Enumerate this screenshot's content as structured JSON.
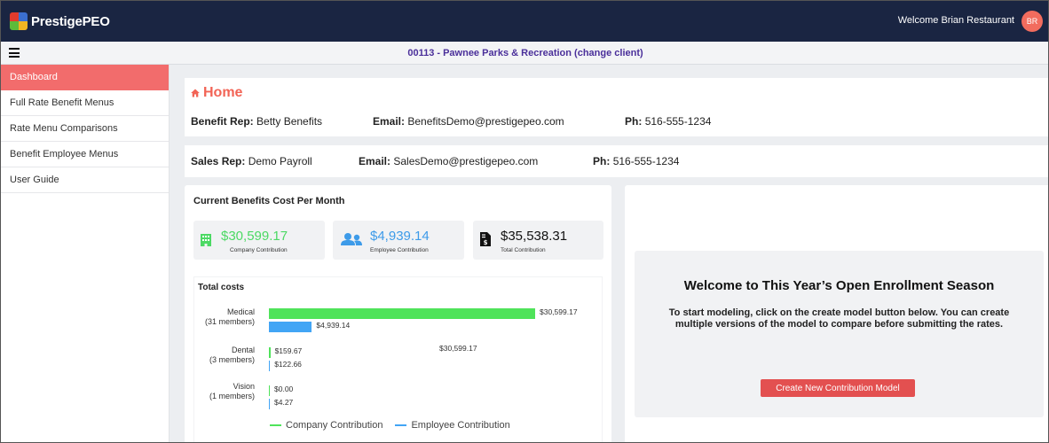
{
  "app": {
    "logo_text": "PrestigePEO",
    "welcome_text": "Welcome Brian Restaurant",
    "avatar_initials": "BR"
  },
  "client": {
    "title": "00113 - Pawnee Parks & Recreation (change client)"
  },
  "sidebar": {
    "items": [
      {
        "label": "Dashboard",
        "active": true
      },
      {
        "label": "Full Rate Benefit Menus",
        "active": false
      },
      {
        "label": "Rate Menu Comparisons",
        "active": false
      },
      {
        "label": "Benefit Employee Menus",
        "active": false
      },
      {
        "label": "User Guide",
        "active": false
      }
    ]
  },
  "home": {
    "title": "Home",
    "benefit_rep_label": "Benefit Rep:",
    "benefit_rep": "Betty Benefits",
    "benefit_email_label": "Email:",
    "benefit_email": "BenefitsDemo@prestigepeo.com",
    "benefit_phone_label": "Ph:",
    "benefit_phone": "516-555-1234",
    "sales_rep_label": "Sales Rep:",
    "sales_rep": "Demo Payroll",
    "sales_email_label": "Email:",
    "sales_email": "SalesDemo@prestigepeo.com",
    "sales_phone_label": "Ph:",
    "sales_phone": "516-555-1234"
  },
  "costs": {
    "title": "Current Benefits Cost Per Month",
    "stats": [
      {
        "amount": "$30,599.17",
        "label": "Company Contribution",
        "color": "#4cd964",
        "icon": "building-icon"
      },
      {
        "amount": "$4,939.14",
        "label": "Employee Contribution",
        "color": "#3d9be9",
        "icon": "users-icon"
      },
      {
        "amount": "$35,538.31",
        "label": "Total Contribution",
        "color": "#111111",
        "icon": "invoice-icon"
      }
    ]
  },
  "chart_data": {
    "type": "bar",
    "orientation": "horizontal",
    "title": "Total costs",
    "categories": [
      "Medical\n(31 members)",
      "Dental\n(3 members)",
      "Vision\n(1 members)"
    ],
    "category_names": [
      "Medical",
      "Dental",
      "Vision"
    ],
    "category_members": [
      "(31 members)",
      "(3 members)",
      "(1 members)"
    ],
    "series": [
      {
        "name": "Company Contribution",
        "color": "#4fe35a",
        "values": [
          30599.17,
          159.67,
          0.0
        ],
        "labels": [
          "$30,599.17",
          "$159.67",
          "$0.00"
        ]
      },
      {
        "name": "Employee Contribution",
        "color": "#42a5f5",
        "values": [
          4939.14,
          122.66,
          4.27
        ],
        "labels": [
          "$4,939.14",
          "$122.66",
          "$4.27"
        ]
      }
    ],
    "xlim": [
      0,
      30599.17
    ],
    "annotation": "$30,599.17",
    "legend": "bottom",
    "grid": false
  },
  "enrollment": {
    "title": "Welcome to This Year’s Open Enrollment Season",
    "text": "To start modeling, click on the create model button below. You can create multiple versions of the model to compare before submitting the rates.",
    "button_label": "Create New Contribution Model"
  }
}
